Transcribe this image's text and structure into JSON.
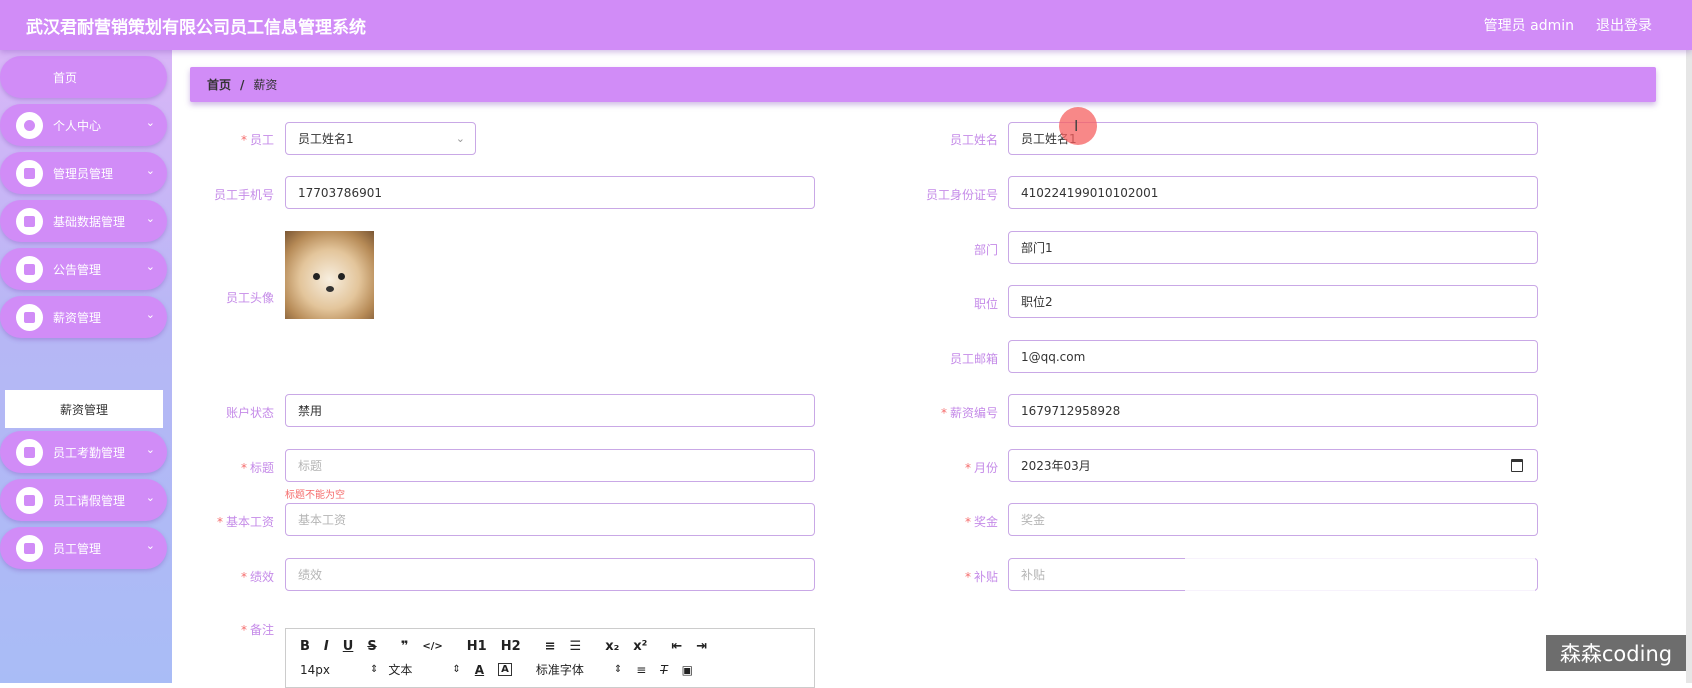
{
  "header": {
    "app_title": "武汉君耐营销策划有限公司员工信息管理系统",
    "user_label": "管理员 admin",
    "logout_label": "退出登录"
  },
  "sidebar": {
    "items": [
      {
        "label": "首页",
        "icon": "home-icon"
      },
      {
        "label": "个人中心",
        "icon": "user-icon"
      },
      {
        "label": "管理员管理",
        "icon": "admin-icon"
      },
      {
        "label": "基础数据管理",
        "icon": "clipboard-icon"
      },
      {
        "label": "公告管理",
        "icon": "grid-icon"
      },
      {
        "label": "薪资管理",
        "icon": "grid-icon"
      },
      {
        "label": "员工考勤管理",
        "icon": "grid-icon"
      },
      {
        "label": "员工请假管理",
        "icon": "chat-icon"
      },
      {
        "label": "员工管理",
        "icon": "grid-icon"
      }
    ],
    "sub_item": "薪资管理",
    "chevron": "⌄"
  },
  "breadcrumb": {
    "home": "首页",
    "separator": "/",
    "current": "薪资"
  },
  "form": {
    "employee": {
      "label": "员工",
      "value": "员工姓名1"
    },
    "employee_name": {
      "label": "员工姓名",
      "value": "员工姓名1"
    },
    "phone": {
      "label": "员工手机号",
      "value": "17703786901"
    },
    "id_card": {
      "label": "员工身份证号",
      "value": "410224199010102001"
    },
    "department": {
      "label": "部门",
      "value": "部门1"
    },
    "avatar": {
      "label": "员工头像"
    },
    "position": {
      "label": "职位",
      "value": "职位2"
    },
    "email": {
      "label": "员工邮箱",
      "value": "1@qq.com"
    },
    "account_status": {
      "label": "账户状态",
      "value": "禁用"
    },
    "salary_no": {
      "label": "薪资编号",
      "value": "1679712958928"
    },
    "title": {
      "label": "标题",
      "placeholder": "标题",
      "error": "标题不能为空"
    },
    "month": {
      "label": "月份",
      "value": "2023年03月"
    },
    "base_salary": {
      "label": "基本工资",
      "placeholder": "基本工资"
    },
    "bonus": {
      "label": "奖金",
      "placeholder": "奖金"
    },
    "performance": {
      "label": "绩效",
      "placeholder": "绩效"
    },
    "allowance": {
      "label": "补贴",
      "placeholder": "补贴"
    },
    "remark": {
      "label": "备注"
    },
    "required_mark": "*"
  },
  "editor": {
    "row1": [
      "B",
      "I",
      "U",
      "S",
      "❞",
      "</>",
      "H1",
      "H2",
      "≡",
      "☰",
      "x₂",
      "x²",
      "⇤",
      "⇥"
    ],
    "font_size": "14px",
    "block_type": "文本",
    "font_family": "标准字体"
  },
  "watermark": "森森coding",
  "colors": {
    "accent": "#d18cf7",
    "label": "#c58be8",
    "error": "#f56c6c"
  }
}
